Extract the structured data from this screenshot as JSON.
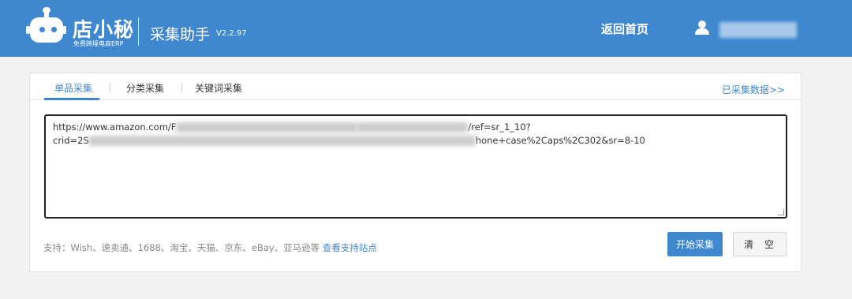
{
  "header": {
    "brand_name": "店小秘",
    "brand_sub": "免费跨境电商ERP",
    "app_title": "采集助手",
    "app_version": "V2.2.97",
    "back_home": "返回首页"
  },
  "tabs": [
    {
      "label": "单品采集",
      "active": true
    },
    {
      "label": "分类采集",
      "active": false
    },
    {
      "label": "关键词采集",
      "active": false
    }
  ],
  "collected_link": "已采集数据>>",
  "url_input": {
    "line1_start": "https://www.amazon.com/F",
    "line1_end": "/ref=sr_1_10?",
    "line2_start": "crid=2S",
    "line2_end": "hone+case%2Caps%2C302&sr=8-10"
  },
  "support": {
    "text": "支持：Wish、速卖通、1688、淘宝、天猫、京东、eBay、亚马逊等",
    "link": "查看支持站点"
  },
  "buttons": {
    "start": "开始采集",
    "clear": "清空"
  },
  "colors": {
    "header_bg": "#3f87cf",
    "accent": "#3f87cf"
  },
  "icons": [
    "robot-logo-icon",
    "user-icon"
  ]
}
